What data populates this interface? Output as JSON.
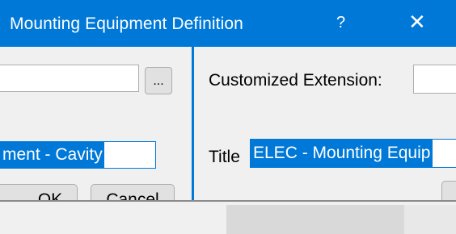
{
  "window": {
    "title": "Mounting Equipment Definition",
    "help_glyph": "?",
    "close_glyph": "✕"
  },
  "left_pane": {
    "path_value": "",
    "browse_label": "...",
    "title_value": "ment - Cavity",
    "ok_label": "OK",
    "cancel_label": "Cancel"
  },
  "right_pane": {
    "extension_label": "Customized Extension:",
    "extension_value": "",
    "title_label": "Title",
    "title_value": "ELEC - Mounting Equip"
  },
  "colors": {
    "accent": "#0078d7",
    "panel": "#f0f0f0"
  }
}
